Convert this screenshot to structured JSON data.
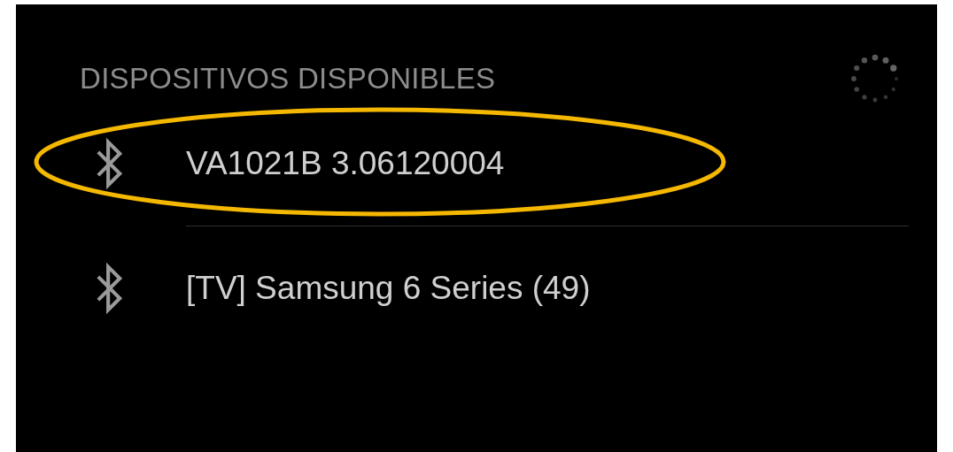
{
  "section": {
    "title": "DISPOSITIVOS DISPONIBLES",
    "scanning": true
  },
  "devices": [
    {
      "name": "VA1021B 3.06120004",
      "highlighted": true
    },
    {
      "name": "[TV] Samsung 6 Series (49)",
      "highlighted": false
    }
  ]
}
